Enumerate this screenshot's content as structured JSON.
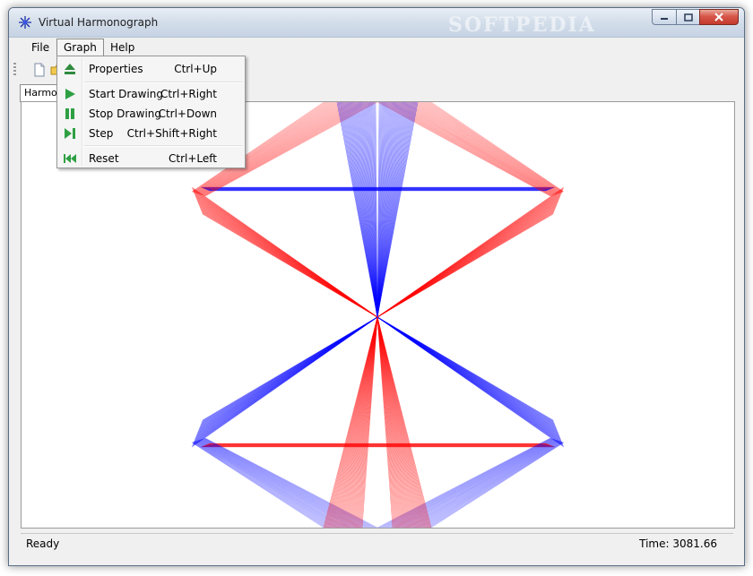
{
  "window": {
    "title": "Virtual Harmonograph",
    "watermark": "SOFTPEDIA"
  },
  "menubar": {
    "file": "File",
    "graph": "Graph",
    "help": "Help"
  },
  "tab": {
    "label": "Harmonograph"
  },
  "graph_menu": {
    "items": [
      {
        "label": "Properties",
        "shortcut": "Ctrl+Up",
        "icon": "properties-icon"
      },
      {
        "label": "Start Drawing",
        "shortcut": "Ctrl+Right",
        "icon": "play-icon"
      },
      {
        "label": "Stop Drawing",
        "shortcut": "Ctrl+Down",
        "icon": "pause-icon"
      },
      {
        "label": "Step",
        "shortcut": "Ctrl+Shift+Right",
        "icon": "step-icon"
      },
      {
        "label": "Reset",
        "shortcut": "Ctrl+Left",
        "icon": "rewind-icon"
      }
    ]
  },
  "status": {
    "left": "Ready",
    "time": "Time: 3081.66"
  },
  "colors": {
    "red": "#ff0000",
    "blue": "#0000ff",
    "menu_icon_green": "#2ea043"
  }
}
